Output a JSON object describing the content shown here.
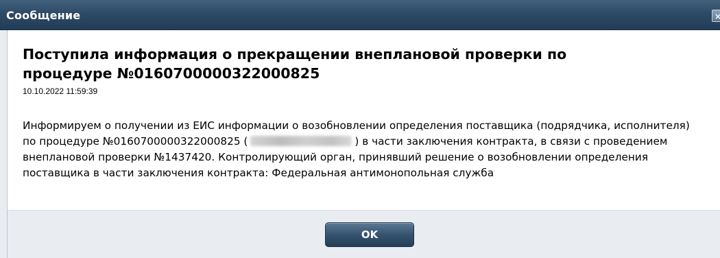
{
  "window": {
    "title": "Сообщение",
    "close_label": "×"
  },
  "message": {
    "heading": "Поступила информация о прекращении внеплановой проверки по процедуре №0160700000322000825",
    "timestamp": "10.10.2022 11:59:39",
    "body_part1": "Информируем о получении из ЕИС информации о возобновлении определения поставщика (подрядчика, исполнителя) по процедуре №0160700000322000825 (",
    "body_part2": ") в части заключения контракта, в связи с проведением внеплановой проверки №1437420. Контролирующий орган, принявший решение о возобновлении определения поставщика в части заключения контракта: Федеральная антимонопольная служба"
  },
  "footer": {
    "ok_label": "OK"
  },
  "colors": {
    "titlebar": "#2d4a66",
    "footer_bg": "#e9edf1",
    "button": "#36536f"
  }
}
